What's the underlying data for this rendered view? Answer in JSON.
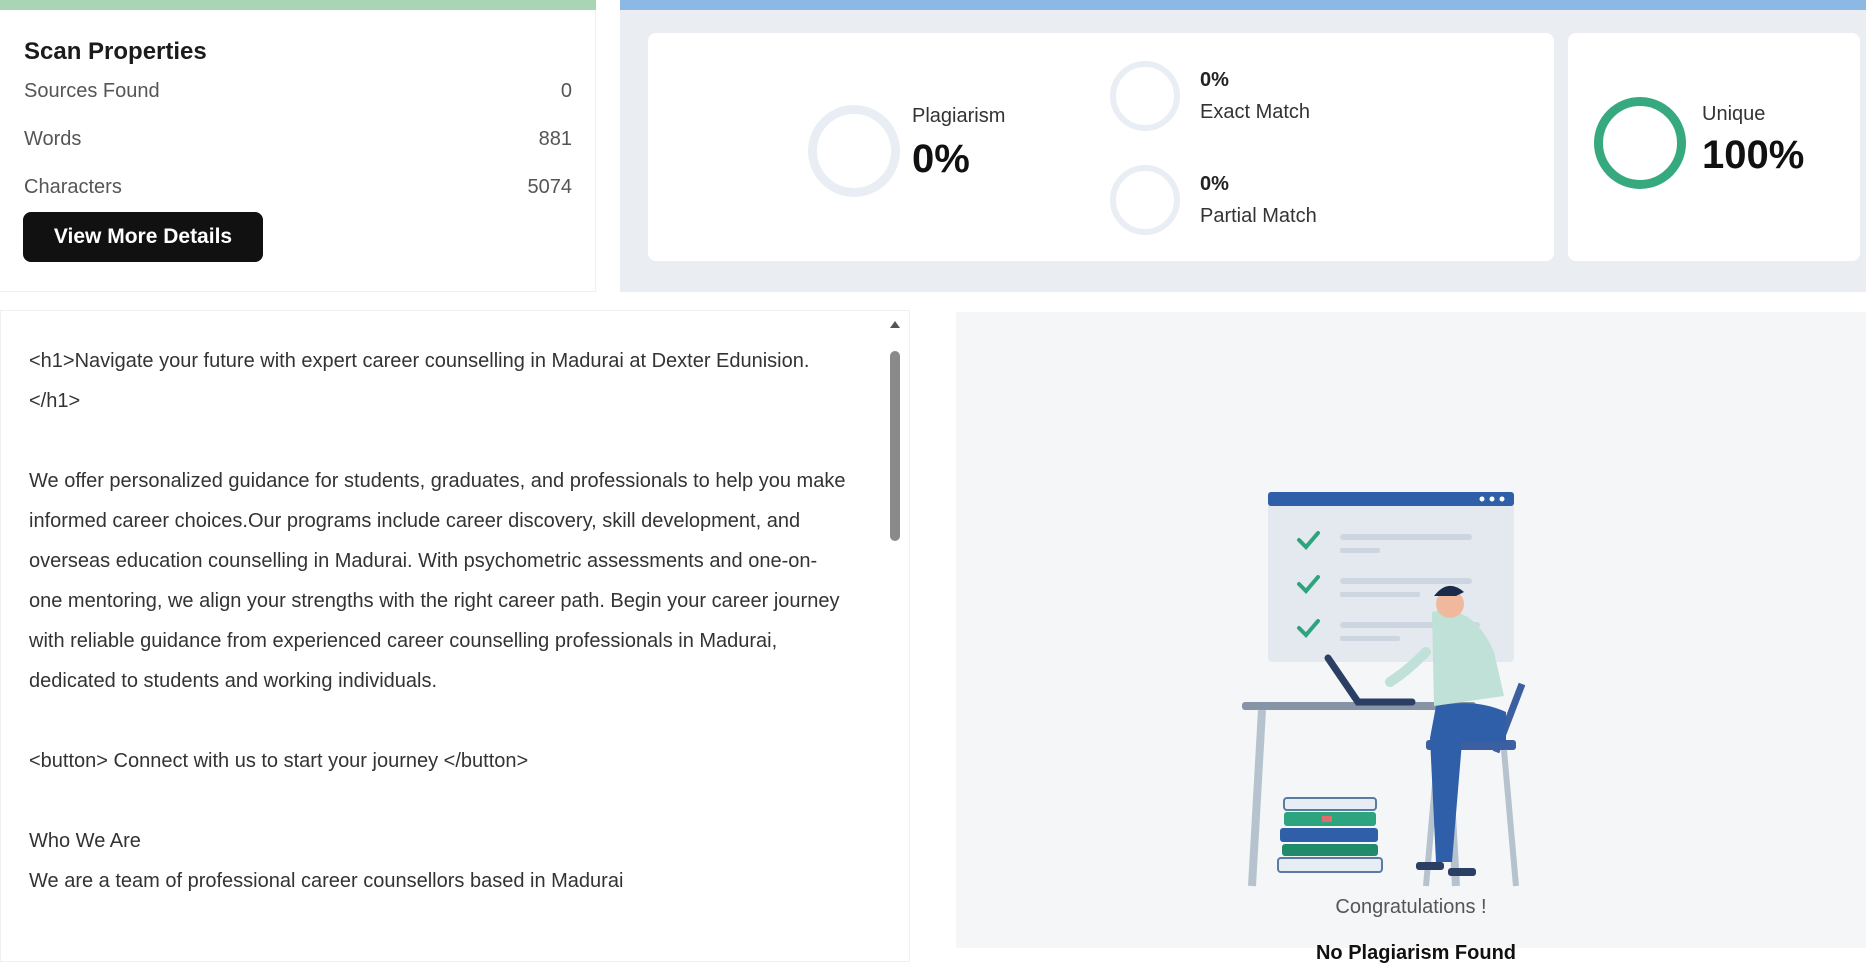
{
  "scan": {
    "title": "Scan Properties",
    "rows": [
      {
        "label": "Sources Found",
        "value": "0"
      },
      {
        "label": "Words",
        "value": "881"
      },
      {
        "label": "Characters",
        "value": "5074"
      }
    ],
    "button_label": "View More Details"
  },
  "results": {
    "plagiarism_label": "Plagiarism",
    "plagiarism_value": "0%",
    "exact_value": "0%",
    "exact_label": "Exact Match",
    "partial_value": "0%",
    "partial_label": "Partial Match",
    "unique_label": "Unique",
    "unique_value": "100%",
    "unique_fraction": 1.0,
    "accent_green": "#36a97e",
    "ring_grey": "#e8eef4"
  },
  "text": {
    "paragraphs": [
      "<h1>Navigate your future with expert career counselling in Madurai at Dexter Edunision. </h1>",
      "We offer personalized guidance for students, graduates, and professionals to help you make informed career choices.Our programs include career discovery, skill development, and overseas education counselling in Madurai. With psychometric assessments and one-on-one mentoring, we align your strengths with the right career path. Begin your career journey with reliable guidance from experienced career counselling professionals in Madurai, dedicated to students and working individuals.",
      "<button> Connect with us to start your journey </button>",
      "Who We Are",
      "We are a team of professional career counsellors based in Madurai"
    ]
  },
  "illustration": {
    "congrats": "Congratulations !",
    "status": "No Plagiarism Found"
  }
}
